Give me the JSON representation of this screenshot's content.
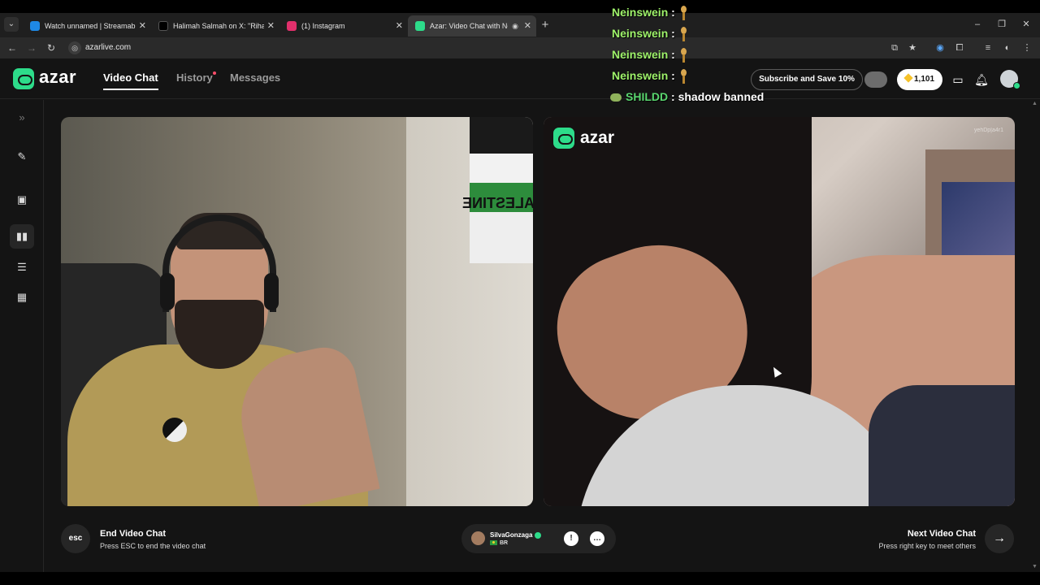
{
  "browser": {
    "tabs": [
      {
        "title": "Watch unnamed | Streamable",
        "favicon_color": "#1e88e5"
      },
      {
        "title": "Halimah Salmah on X: \"Rihann",
        "favicon_color": "#000000"
      },
      {
        "title": "(1) Instagram",
        "favicon_color": "#e1306c"
      },
      {
        "title": "Azar: Video Chat with New",
        "favicon_color": "#2ddc8a"
      }
    ],
    "url": "azarlive.com"
  },
  "app": {
    "logo": "azar",
    "nav": {
      "video_chat": "Video Chat",
      "history": "History",
      "messages": "Messages"
    },
    "subscribe_label": "Subscribe and Save 10%",
    "coins": "1,101"
  },
  "overlay_chat": [
    {
      "user": "Neinswein",
      "sep": " :",
      "message": ""
    },
    {
      "user": "Neinswein",
      "sep": " :",
      "message": ""
    },
    {
      "user": "Neinswein",
      "sep": " :",
      "message": ""
    },
    {
      "user": "Neinswein",
      "sep": " :",
      "message": ""
    },
    {
      "user": "SHILDD",
      "sep": " :",
      "message": " shadow banned"
    }
  ],
  "video": {
    "left_sign_text": "ALESTINE",
    "right_logo": "azar",
    "right_watermark": "yehDp|a4r1"
  },
  "bottom": {
    "esc_label": "esc",
    "end_title": "End Video Chat",
    "end_sub": "Press ESC to end the video chat",
    "partner_name": "SilvaGonzaga",
    "partner_country": "BR",
    "next_title": "Next Video Chat",
    "next_sub": "Press right key to meet others"
  },
  "colors": {
    "brand": "#2ddc8a",
    "chat_name": "#9ef26a",
    "notification_dot": "#ff4d6a"
  }
}
